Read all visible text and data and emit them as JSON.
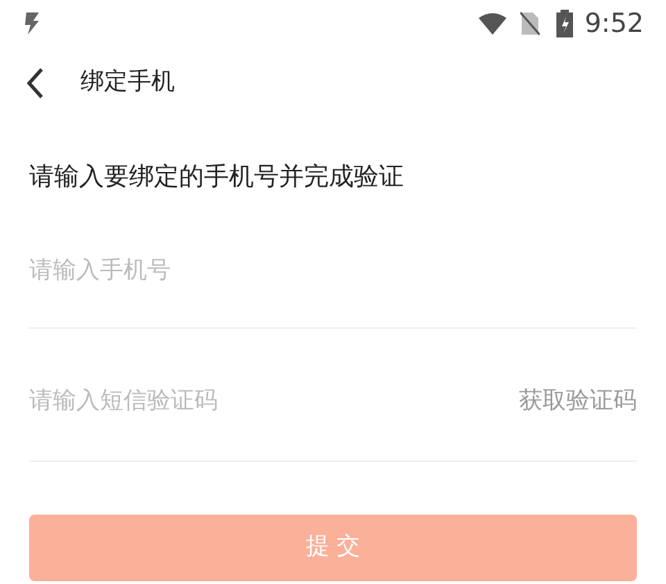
{
  "status_bar": {
    "time": "9:52"
  },
  "header": {
    "title": "绑定手机"
  },
  "prompt": "请输入要绑定的手机号并完成验证",
  "phone_field": {
    "placeholder": "请输入手机号"
  },
  "code_field": {
    "placeholder": "请输入短信验证码",
    "action": "获取验证码"
  },
  "submit": {
    "label": "提 交",
    "disabled": true
  }
}
